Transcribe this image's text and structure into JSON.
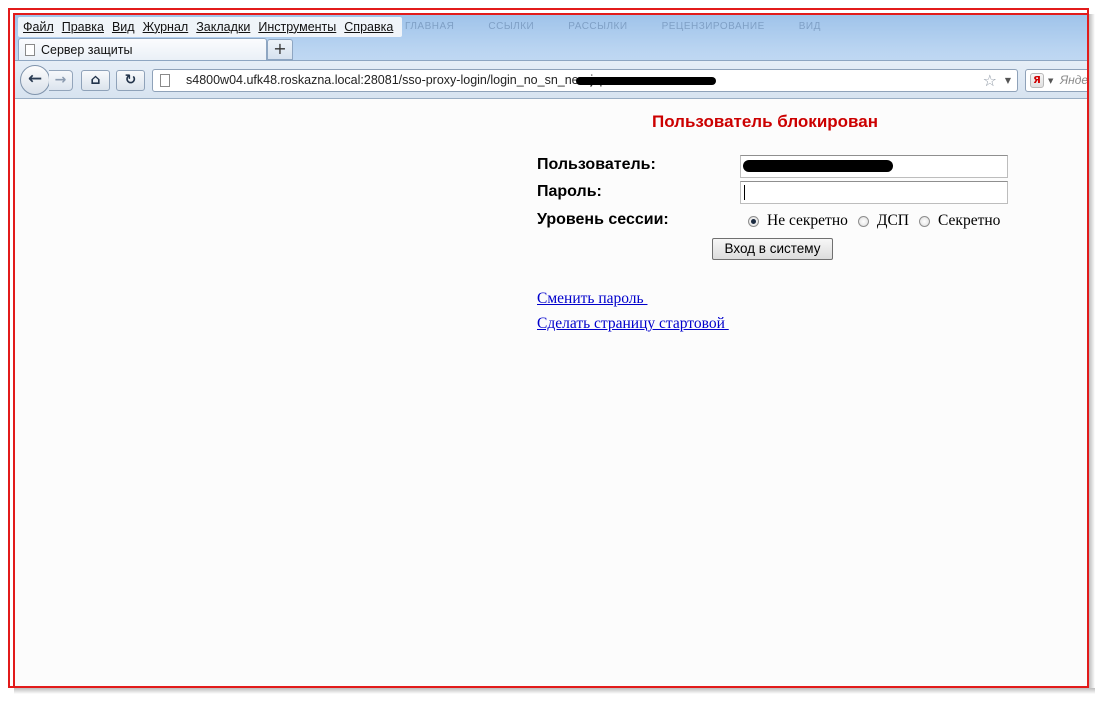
{
  "browser": {
    "menu": [
      "Файл",
      "Правка",
      "Вид",
      "Журнал",
      "Закладки",
      "Инструменты",
      "Справка"
    ],
    "background_menu": [
      "ГЛАВНАЯ",
      "ССЫЛКИ",
      "РАССЫЛКИ",
      "РЕЦЕНЗИРОВАНИЕ",
      "ВИД"
    ],
    "tab_title": "Сервер защиты",
    "new_tab": "+",
    "url": "s4800w04.ufk48.roskazna.local:28081/sso-proxy-login/login_no_sn_new.jsp",
    "search_placeholder": "Янде",
    "icons": {
      "back": "←",
      "forward": "→",
      "home": "⌂",
      "reload": "↻",
      "star": "☆",
      "yandex": "Я"
    }
  },
  "page": {
    "status_message": "Пользователь блокирован",
    "status_color": "#cc0000",
    "user_label": "Пользователь:",
    "password_label": "Пароль:",
    "session_label": "Уровень сессии:",
    "session_options": [
      "Не секретно",
      "ДСП",
      "Секретно"
    ],
    "session_selected": "Не секретно",
    "login_button": "Вход в систему",
    "link_change_password": "Сменить пароль ",
    "link_set_start_page": "Сделать страницу стартовой "
  }
}
